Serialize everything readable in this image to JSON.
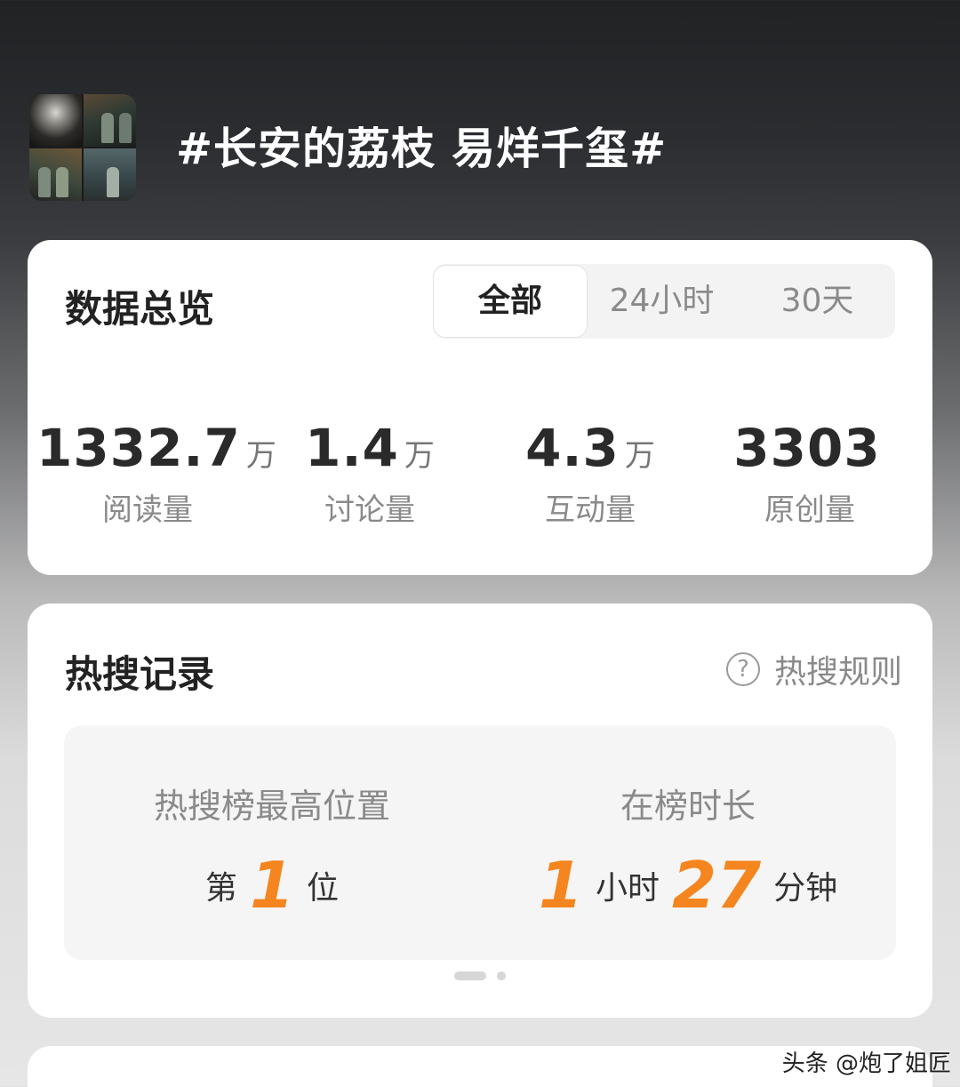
{
  "topic": {
    "title": "#长安的荔枝 易烊千玺#",
    "cover_icon": "drama-stills-collage"
  },
  "overview": {
    "title": "数据总览",
    "tabs": [
      {
        "label": "全部",
        "selected": true
      },
      {
        "label": "24小时",
        "selected": false
      },
      {
        "label": "30天",
        "selected": false
      }
    ],
    "stats": [
      {
        "value": "1332.7",
        "unit": "万",
        "label": "阅读量"
      },
      {
        "value": "1.4",
        "unit": "万",
        "label": "讨论量"
      },
      {
        "value": "4.3",
        "unit": "万",
        "label": "互动量"
      },
      {
        "value": "3303",
        "unit": "",
        "label": "原创量"
      }
    ]
  },
  "hot_search": {
    "title": "热搜记录",
    "rules_label": "热搜规则",
    "rules_icon": "question-circle-icon",
    "peak": {
      "label": "热搜榜最高位置",
      "prefix": "第",
      "rank": "1",
      "suffix": "位"
    },
    "duration": {
      "label": "在榜时长",
      "hours": "1",
      "hours_unit": "小时",
      "minutes": "27",
      "minutes_unit": "分钟"
    },
    "pager": {
      "pages": 2,
      "current": 1
    }
  },
  "watermark": "头条 @炮了姐匠",
  "colors": {
    "accent": "#f5851f",
    "card": "#ffffff",
    "text_primary": "#222222",
    "text_secondary": "#8a8a8a"
  }
}
